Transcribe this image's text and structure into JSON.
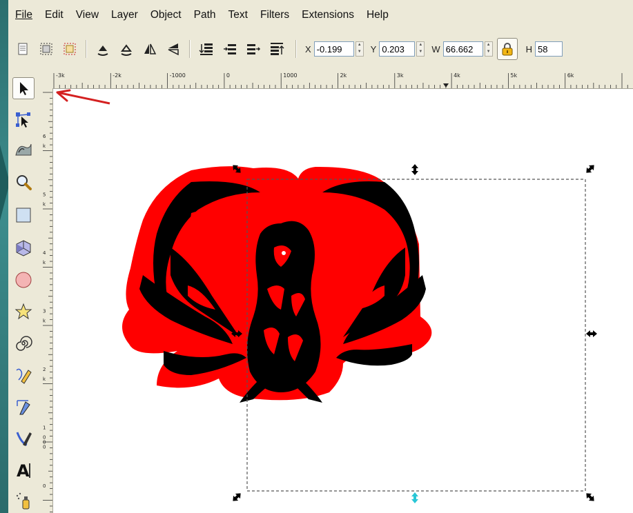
{
  "menu": [
    {
      "label": "File"
    },
    {
      "label": "Edit"
    },
    {
      "label": "View"
    },
    {
      "label": "Layer"
    },
    {
      "label": "Object"
    },
    {
      "label": "Path"
    },
    {
      "label": "Text"
    },
    {
      "label": "Filters"
    },
    {
      "label": "Extensions"
    },
    {
      "label": "Help"
    }
  ],
  "toolbar": {
    "buttons": [
      "select-all-icon",
      "select-all-layers-icon",
      "deselect-icon",
      "rotate-ccw-icon",
      "rotate-cw-icon",
      "flip-horizontal-icon",
      "flip-vertical-icon",
      "lower-to-bottom-icon",
      "lower-icon",
      "raise-icon",
      "raise-to-top-icon"
    ],
    "x_label": "X",
    "x_value": "-0.199",
    "y_label": "Y",
    "y_value": "0.203",
    "w_label": "W",
    "w_value": "66.662",
    "h_label": "H",
    "h_value": "58"
  },
  "tools": [
    "selector-tool-icon",
    "node-tool-icon",
    "tweak-tool-icon",
    "zoom-tool-icon",
    "rectangle-tool-icon",
    "3d-box-tool-icon",
    "ellipse-tool-icon",
    "star-tool-icon",
    "spiral-tool-icon",
    "pencil-tool-icon",
    "pen-tool-icon",
    "calligraphy-tool-icon",
    "text-tool-icon",
    "spray-tool-icon"
  ],
  "hruler": {
    "labels": [
      "-3k",
      "-2k",
      "-1000",
      "0",
      "1000",
      "2k",
      "3k",
      "4k",
      "5k",
      "6k"
    ]
  },
  "vruler": {
    "labels": [
      "6 k",
      "5 k",
      "4 k",
      "3 k",
      "2 k",
      "1 000",
      "0"
    ]
  },
  "colors": {
    "accent_red": "#ff0000",
    "annotation_red": "#d42020"
  }
}
